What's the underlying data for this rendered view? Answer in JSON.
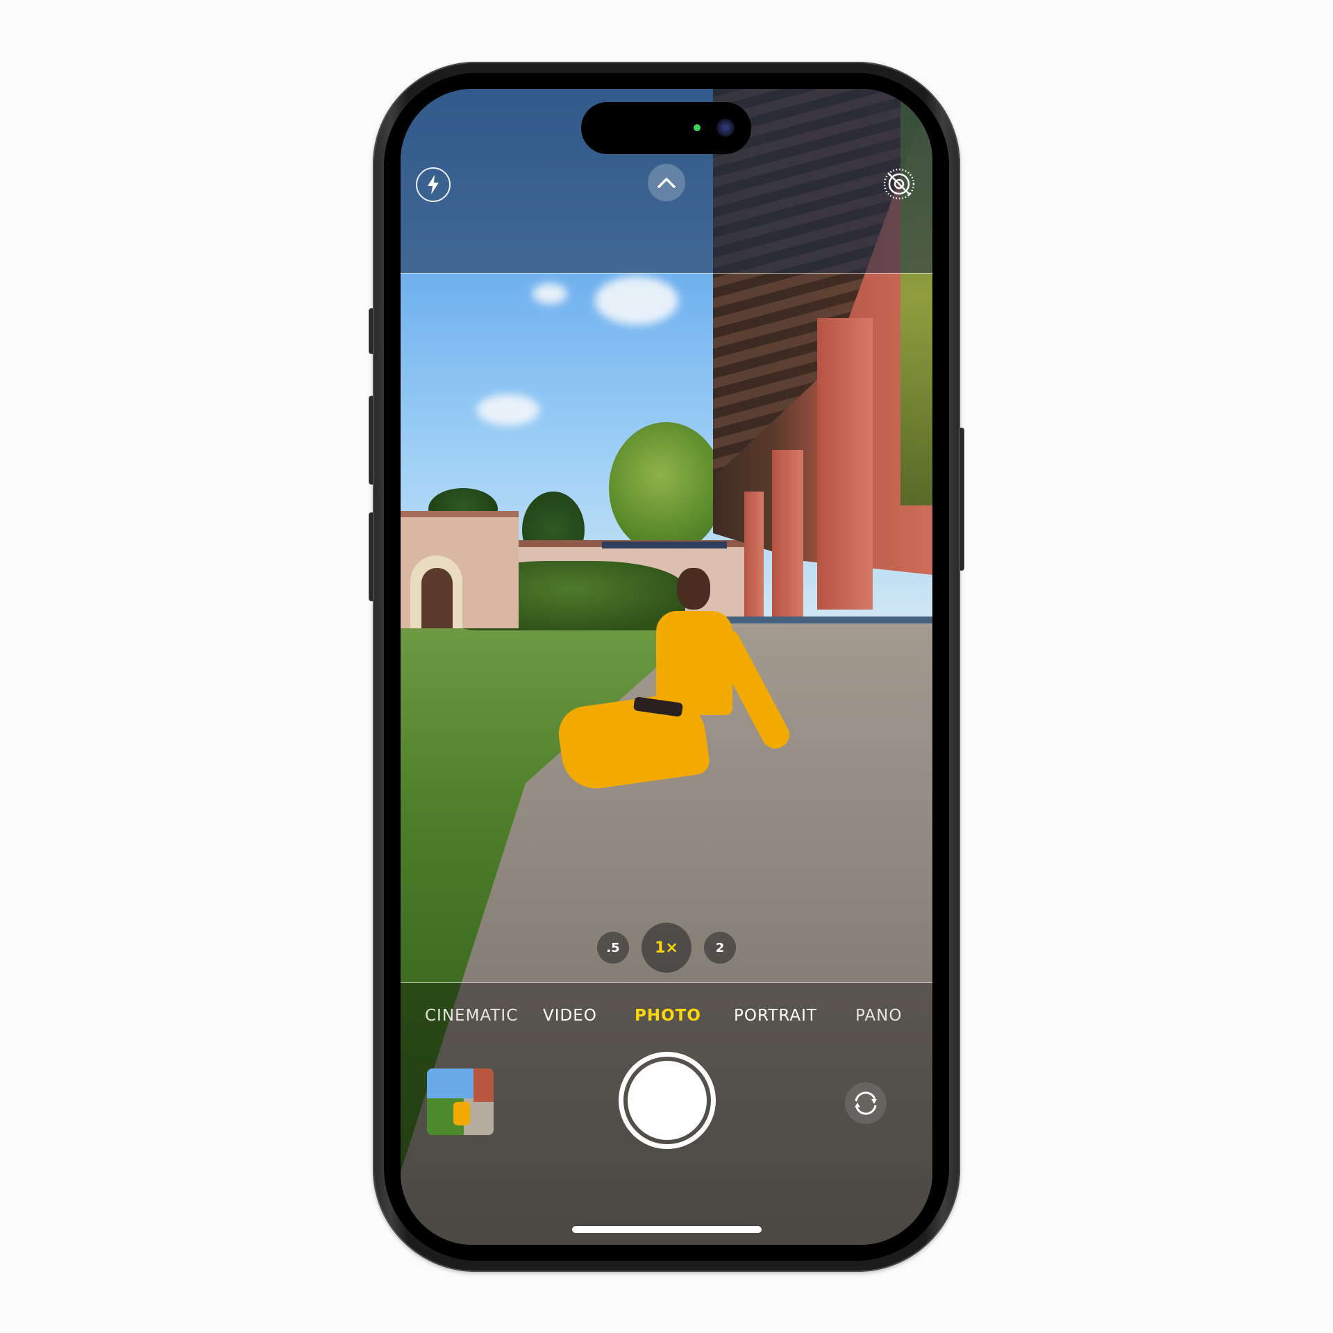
{
  "app": {
    "name": "Camera",
    "accent_color": "#ffd60a",
    "recording_indicator_color": "#3dd35c"
  },
  "top_controls": {
    "flash": {
      "icon": "flash-icon",
      "state": "auto"
    },
    "expand": {
      "icon": "chevron-up-icon"
    },
    "live_photo": {
      "icon": "live-photo-off-icon",
      "state": "off"
    }
  },
  "zoom_levels": [
    {
      "label": ".5",
      "active": false
    },
    {
      "label": "1×",
      "active": true
    },
    {
      "label": "2",
      "active": false
    }
  ],
  "modes": [
    {
      "label": "CINEMATIC",
      "active": false
    },
    {
      "label": "VIDEO",
      "active": false
    },
    {
      "label": "PHOTO",
      "active": true
    },
    {
      "label": "PORTRAIT",
      "active": false
    },
    {
      "label": "PANO",
      "active": false
    }
  ],
  "bottom_controls": {
    "last_photo_thumbnail": {
      "icon": "photo-thumbnail"
    },
    "shutter": {
      "icon": "shutter-button"
    },
    "flip_camera": {
      "icon": "camera-flip-icon"
    }
  }
}
